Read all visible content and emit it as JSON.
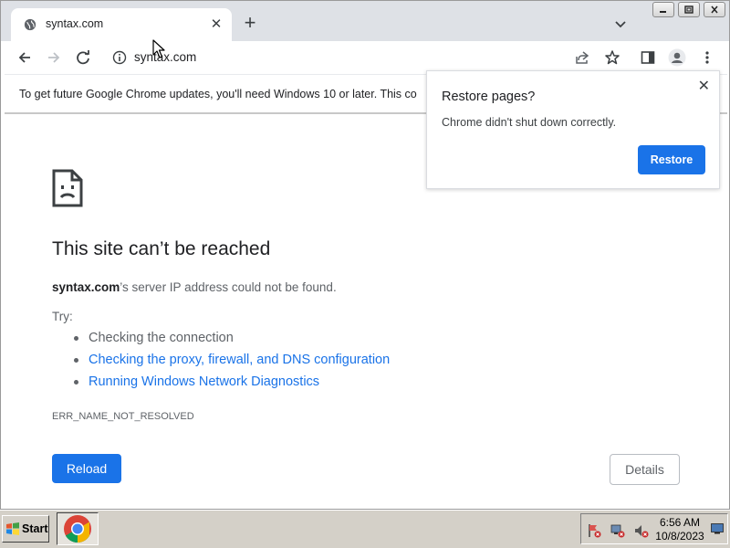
{
  "browser": {
    "tab": {
      "title": "syntax.com",
      "close": "✕"
    },
    "new_tab": "+",
    "window_controls": [
      "_",
      "□",
      "✕"
    ],
    "omnibox": {
      "url": "syntax.com"
    },
    "icons": [
      "back-arrow-icon",
      "forward-arrow-icon",
      "reload-icon",
      "info-icon",
      "share-icon",
      "star-icon",
      "side-panel-icon",
      "profile-icon",
      "menu-dots-icon"
    ]
  },
  "infobar": {
    "message": "To get future Google Chrome updates, you'll need Windows 10 or later. This co"
  },
  "restore_bubble": {
    "title": "Restore pages?",
    "text": "Chrome didn't shut down correctly.",
    "button": "Restore",
    "close": "✕"
  },
  "error_page": {
    "heading": "This site can’t be reached",
    "domain": "syntax.com",
    "description": "’s server IP address could not be found.",
    "try_label": "Try:",
    "suggestions": [
      {
        "text": "Checking the connection",
        "link": false
      },
      {
        "text": "Checking the proxy, firewall, and DNS configuration",
        "link": true
      },
      {
        "text": "Running Windows Network Diagnostics",
        "link": true
      }
    ],
    "error_code": "ERR_NAME_NOT_RESOLVED",
    "reload_button": "Reload",
    "details_button": "Details"
  },
  "taskbar": {
    "start": "Start",
    "time": "6:56 AM",
    "date": "10/8/2023"
  },
  "colors": {
    "accent": "#1a73e8",
    "tabstrip": "#dee1e6",
    "taskbar": "#d4d0c8"
  }
}
